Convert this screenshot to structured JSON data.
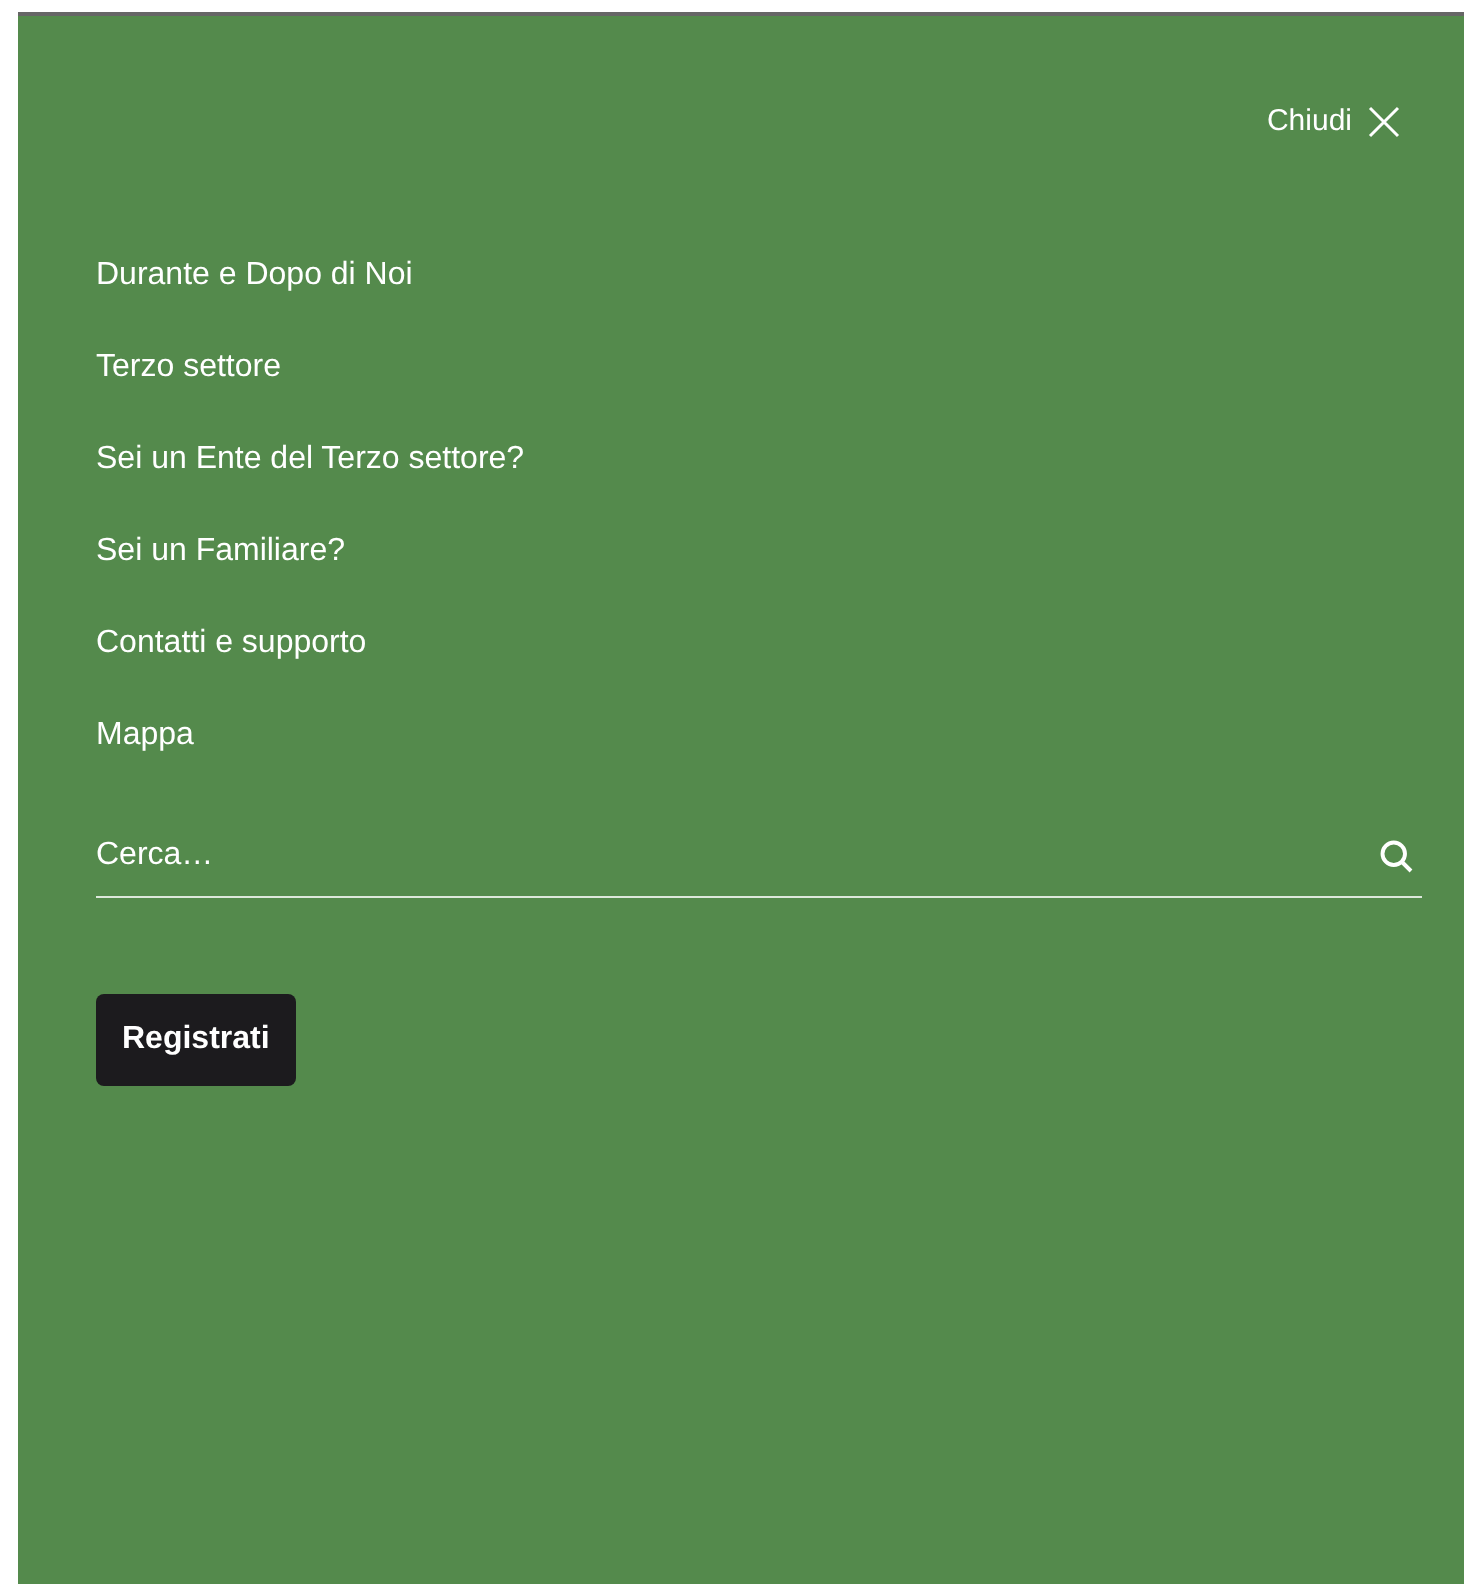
{
  "close_button": {
    "label": "Chiudi"
  },
  "menu": {
    "items": [
      {
        "label": "Durante e Dopo di Noi"
      },
      {
        "label": "Terzo settore"
      },
      {
        "label": "Sei un Ente del Terzo settore?"
      },
      {
        "label": "Sei un Familiare?"
      },
      {
        "label": "Contatti e supporto"
      },
      {
        "label": "Mappa"
      }
    ]
  },
  "search": {
    "placeholder": "Cerca…"
  },
  "register_button": {
    "label": "Registrati"
  }
}
